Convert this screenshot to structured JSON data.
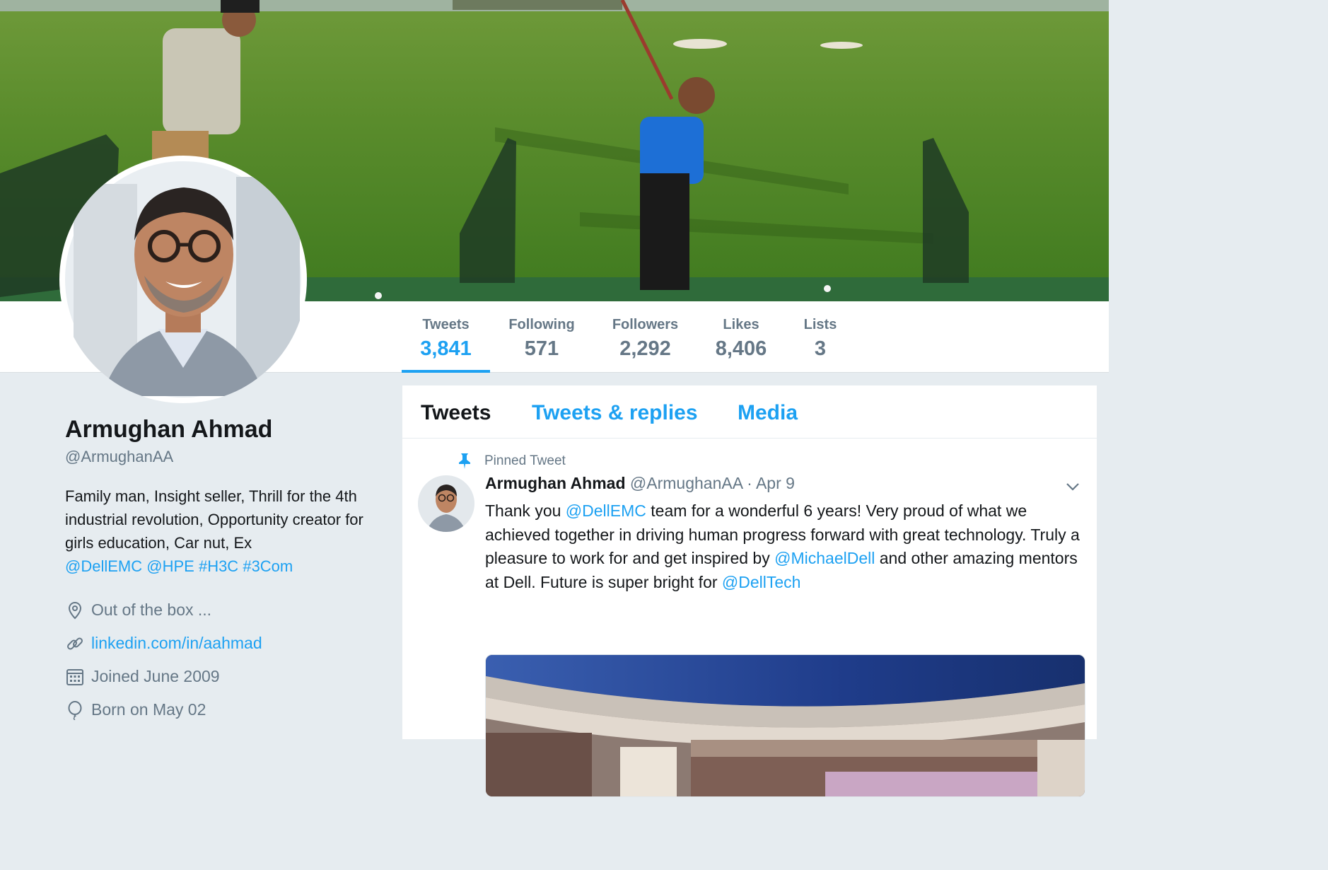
{
  "profile": {
    "name": "Armughan Ahmad",
    "handle": "@ArmughanAA",
    "bio_text": "Family man, Insight seller, Thrill for the 4th industrial revolution, Opportunity creator for girls education, Car nut, Ex",
    "bio_links": [
      "@DellEMC",
      "@HPE",
      "#H3C",
      "#3Com"
    ],
    "location": "Out of the box ...",
    "website": "linkedin.com/in/aahmad",
    "joined": "Joined June 2009",
    "birthday": "Born on May 02"
  },
  "stats": [
    {
      "label": "Tweets",
      "value": "3,841",
      "active": true
    },
    {
      "label": "Following",
      "value": "571",
      "active": false
    },
    {
      "label": "Followers",
      "value": "2,292",
      "active": false
    },
    {
      "label": "Likes",
      "value": "8,406",
      "active": false
    },
    {
      "label": "Lists",
      "value": "3",
      "active": false
    }
  ],
  "tabs": [
    {
      "label": "Tweets",
      "active": true
    },
    {
      "label": "Tweets & replies",
      "active": false
    },
    {
      "label": "Media",
      "active": false
    }
  ],
  "tweet": {
    "pinned_label": "Pinned Tweet",
    "author_name": "Armughan Ahmad",
    "author_handle": "@ArmughanAA",
    "date": "· Apr 9",
    "text_1": "Thank you ",
    "mention_1": "@DellEMC",
    "text_2": " team for a wonderful 6 years! Very proud of what we achieved together in driving human progress forward with great technology. Truly a pleasure to work for and get inspired by ",
    "mention_2": "@MichaelDell",
    "text_3": " and other amazing mentors at Dell. Future is super bright for ",
    "mention_3": "@DellTech"
  },
  "icons": {
    "location": "location-pin-icon",
    "website": "link-icon",
    "joined": "calendar-icon",
    "birthday": "balloon-icon",
    "pin": "pin-icon",
    "caret": "chevron-down-icon"
  },
  "colors": {
    "accent": "#1da1f2",
    "muted": "#657786",
    "text": "#14171a",
    "background": "#e6ecf0"
  }
}
